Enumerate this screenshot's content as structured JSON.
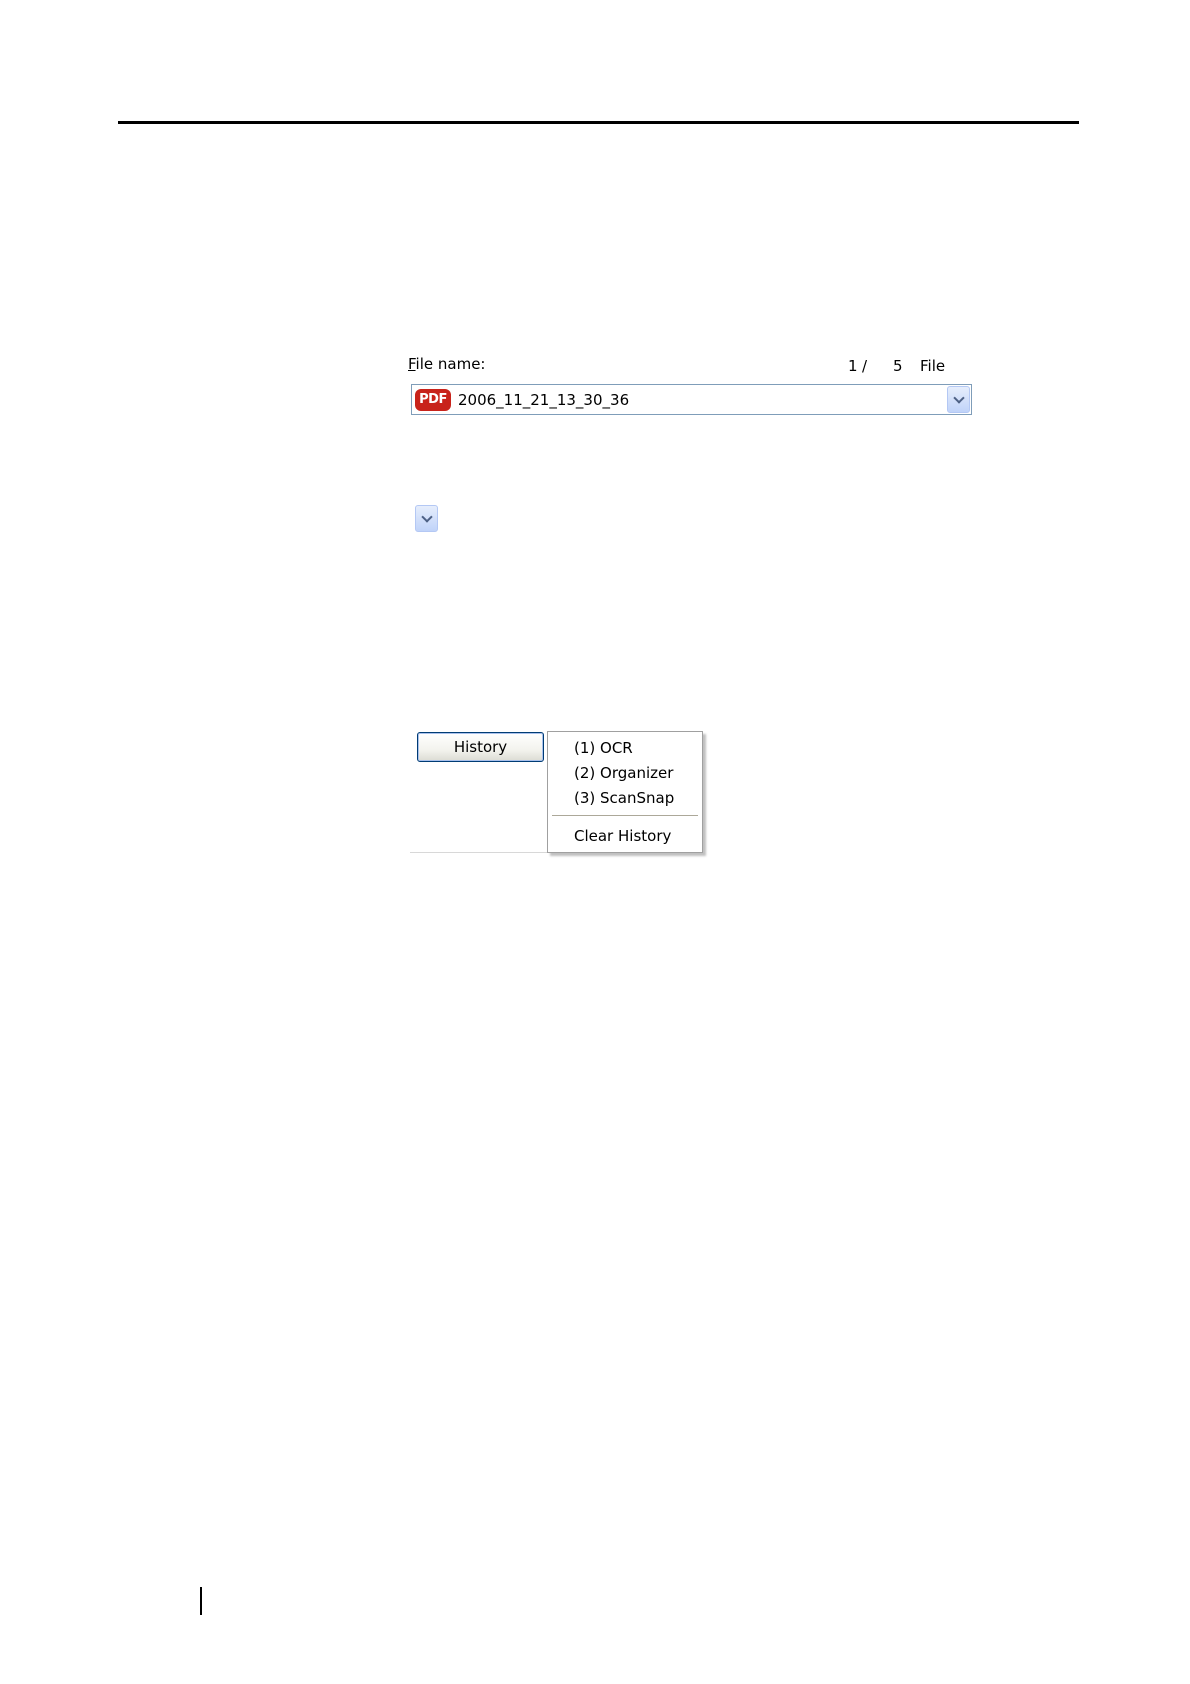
{
  "file_panel": {
    "label_mnemonic": "F",
    "label_rest": "ile name:",
    "counter": {
      "current": "1",
      "separator": "/",
      "total": "5",
      "unit": "File"
    },
    "combo": {
      "badge": "PDF",
      "value": "2006_11_21_13_30_36"
    }
  },
  "history": {
    "button_label": "History",
    "menu_items": [
      "(1) OCR",
      "(2) Organizer",
      "(3) ScanSnap"
    ],
    "clear_label": "Clear History"
  },
  "colors": {
    "pdf_badge": "#c8231b",
    "combo_border": "#7f9db9",
    "arrow_button": "#c0d3f9",
    "button_border": "#003c74"
  }
}
